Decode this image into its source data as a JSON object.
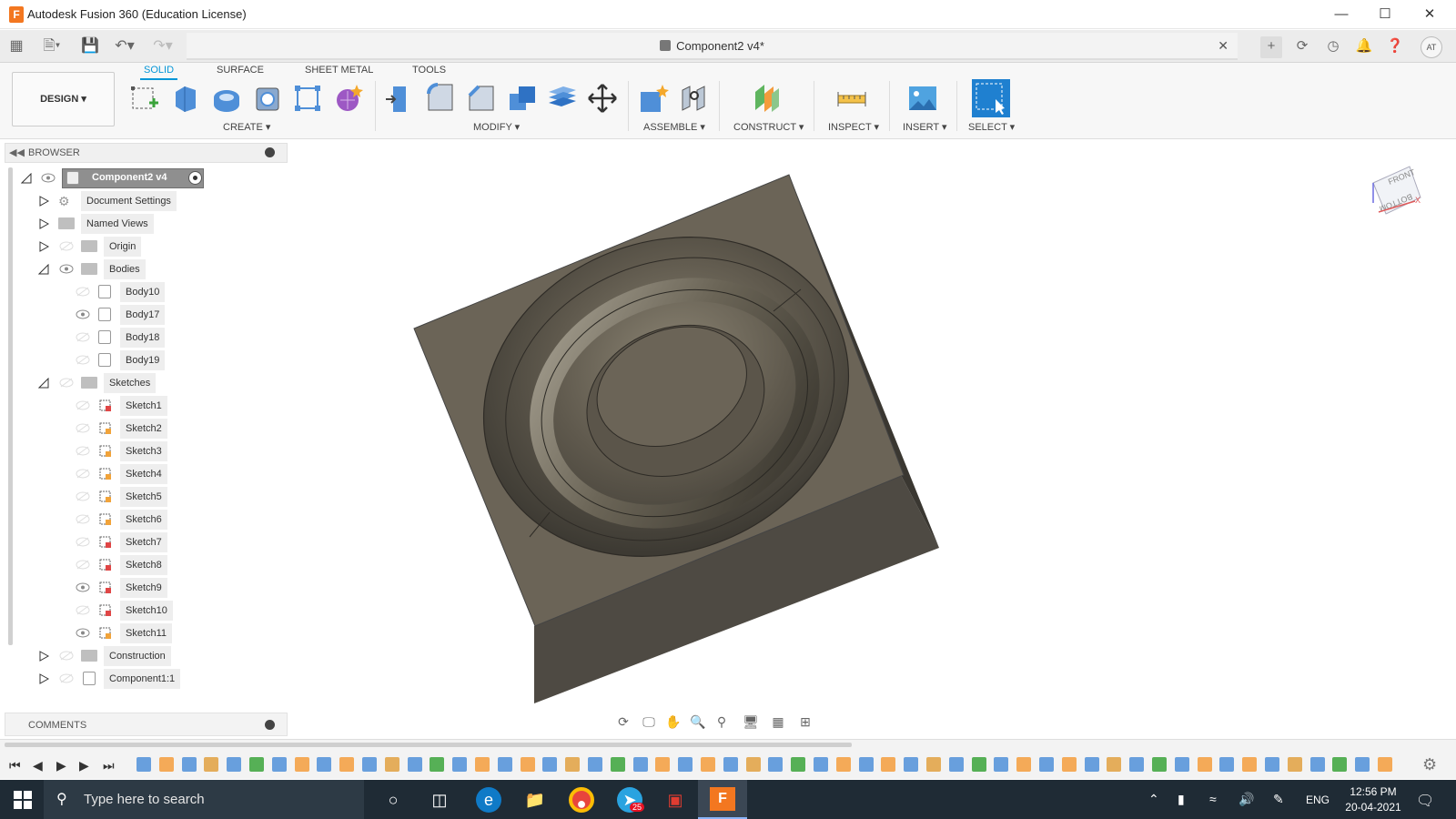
{
  "window": {
    "title": "Autodesk Fusion 360 (Education License)",
    "app_icon": "F"
  },
  "document": {
    "tab_title": "Component2 v4*"
  },
  "user": {
    "initials": "AT"
  },
  "ribbon": {
    "workspace": "DESIGN",
    "tabs": [
      {
        "label": "SOLID",
        "active": true
      },
      {
        "label": "SURFACE",
        "active": false
      },
      {
        "label": "SHEET METAL",
        "active": false
      },
      {
        "label": "TOOLS",
        "active": false
      }
    ],
    "groups": [
      "CREATE",
      "MODIFY",
      "ASSEMBLE",
      "CONSTRUCT",
      "INSPECT",
      "INSERT",
      "SELECT"
    ]
  },
  "browser": {
    "title": "BROWSER",
    "root": "Component2 v4",
    "nodes": [
      {
        "label": "Document Settings"
      },
      {
        "label": "Named Views"
      },
      {
        "label": "Origin"
      },
      {
        "label": "Bodies"
      },
      {
        "label": "Body10"
      },
      {
        "label": "Body17"
      },
      {
        "label": "Body18"
      },
      {
        "label": "Body19"
      },
      {
        "label": "Sketches"
      },
      {
        "label": "Sketch1"
      },
      {
        "label": "Sketch2"
      },
      {
        "label": "Sketch3"
      },
      {
        "label": "Sketch4"
      },
      {
        "label": "Sketch5"
      },
      {
        "label": "Sketch6"
      },
      {
        "label": "Sketch7"
      },
      {
        "label": "Sketch8"
      },
      {
        "label": "Sketch9"
      },
      {
        "label": "Sketch10"
      },
      {
        "label": "Sketch11"
      },
      {
        "label": "Construction"
      },
      {
        "label": "Component1:1"
      }
    ]
  },
  "comments": {
    "title": "COMMENTS"
  },
  "viewcube": {
    "face_top": "FRONT",
    "face_side": "BOTTOM",
    "axis": "X"
  },
  "taskbar": {
    "search_placeholder": "Type here to search",
    "language": "ENG",
    "time": "12:56 PM",
    "date": "20-04-2021",
    "badge": "25"
  },
  "colors": {
    "accent": "#0696d7",
    "model": "#6b6457",
    "taskbar": "#1f2b35"
  }
}
